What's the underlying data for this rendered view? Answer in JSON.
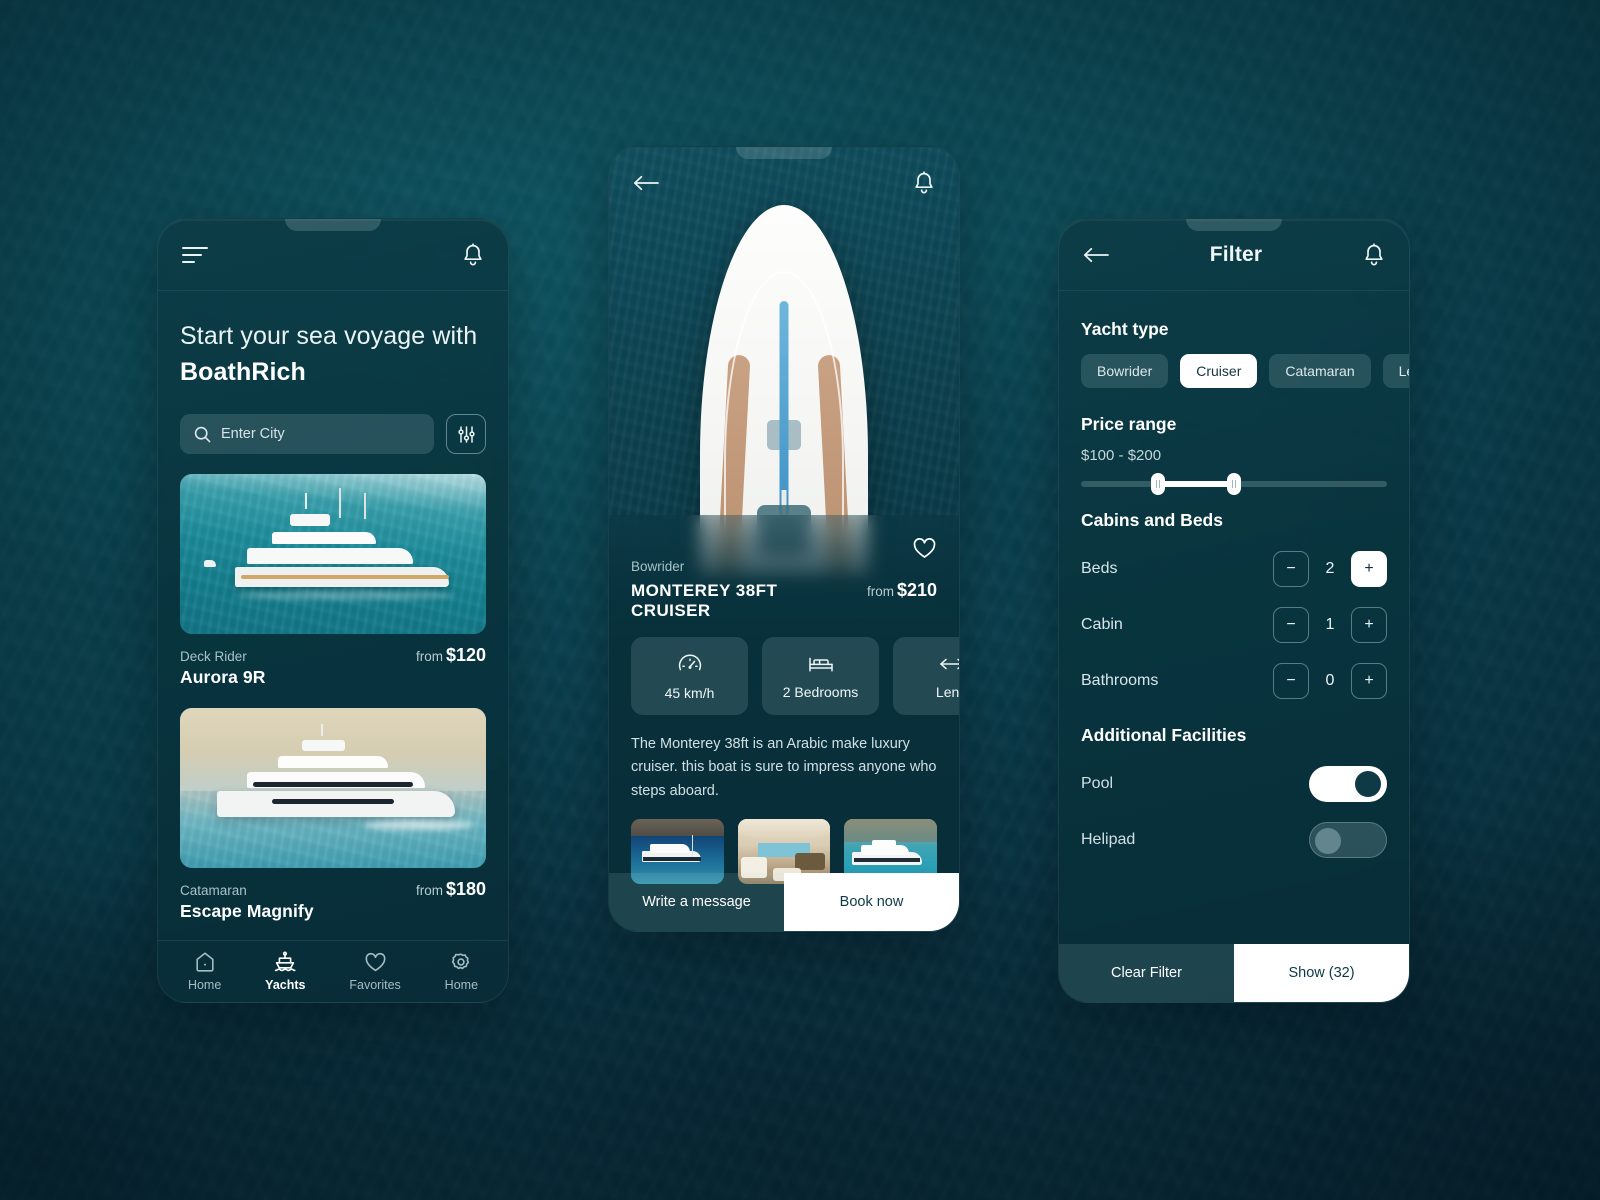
{
  "app": {
    "brand": "BoathRich"
  },
  "home": {
    "menu_icon": "hamburger-icon",
    "bell_icon": "bell-icon",
    "hero_line1": "Start your sea voyage with",
    "hero_brand": "BoathRich",
    "search": {
      "placeholder": "Enter City",
      "value": "",
      "icon": "search-icon"
    },
    "filter_icon": "sliders-icon",
    "cards": [
      {
        "kind": "Deck Rider",
        "name": "Aurora 9R",
        "price_prefix": "from",
        "price": "$120"
      },
      {
        "kind": "Catamaran",
        "name": "Escape Magnify",
        "price_prefix": "from",
        "price": "$180"
      }
    ],
    "tabs": [
      {
        "label": "Home",
        "icon": "home-icon",
        "active": false
      },
      {
        "label": "Yachts",
        "icon": "boat-icon",
        "active": true
      },
      {
        "label": "Favorites",
        "icon": "heart-icon",
        "active": false
      },
      {
        "label": "Home",
        "icon": "gear-icon",
        "active": false
      }
    ]
  },
  "detail": {
    "back_icon": "arrow-left-icon",
    "bell_icon": "bell-icon",
    "favorite_icon": "heart-outline-icon",
    "kind": "Bowrider",
    "title": "MONTEREY 38FT CRUISER",
    "price_prefix": "from",
    "price": "$210",
    "specs": [
      {
        "label": "45 km/h",
        "icon": "speedometer-icon"
      },
      {
        "label": "2 Bedrooms",
        "icon": "bed-icon"
      },
      {
        "label": "Leng",
        "icon": "ruler-icon"
      }
    ],
    "description": "The Monterey 38ft is an Arabic make luxury cruiser. this boat is sure to impress anyone who steps aboard.",
    "gallery": [
      "yacht-anchored-photo",
      "yacht-interior-photo",
      "yacht-cove-photo"
    ],
    "actions": {
      "secondary": "Write a message",
      "primary": "Book now"
    }
  },
  "filter": {
    "back_icon": "arrow-left-icon",
    "bell_icon": "bell-icon",
    "title": "Filter",
    "yacht_type": {
      "heading": "Yacht type",
      "chips": [
        {
          "label": "Bowrider",
          "selected": false
        },
        {
          "label": "Cruiser",
          "selected": true
        },
        {
          "label": "Catamaran",
          "selected": false
        },
        {
          "label": "Leona",
          "selected": false
        }
      ]
    },
    "price_range": {
      "heading": "Price range",
      "value_text": "$100 - $200",
      "min": 0,
      "max": 400,
      "low": 100,
      "high": 200
    },
    "cabins": {
      "heading": "Cabins and Beds",
      "rows": [
        {
          "label": "Beds",
          "value": "2",
          "minus": "−",
          "plus": "+",
          "plus_active": true
        },
        {
          "label": "Cabin",
          "value": "1",
          "minus": "−",
          "plus": "+",
          "plus_active": false
        },
        {
          "label": "Bathrooms",
          "value": "0",
          "minus": "−",
          "plus": "+",
          "plus_active": false
        }
      ]
    },
    "facilities": {
      "heading": "Additional  Facilities",
      "rows": [
        {
          "label": "Pool",
          "on": true
        },
        {
          "label": "Helipad",
          "on": false
        }
      ]
    },
    "actions": {
      "secondary": "Clear Filter",
      "primary": "Show (32)"
    }
  },
  "colors": {
    "background_deep_teal": "#0b4350",
    "panel_teal": "#093440",
    "accent_white": "#ffffff",
    "muted_text": "#a9c3c7"
  }
}
